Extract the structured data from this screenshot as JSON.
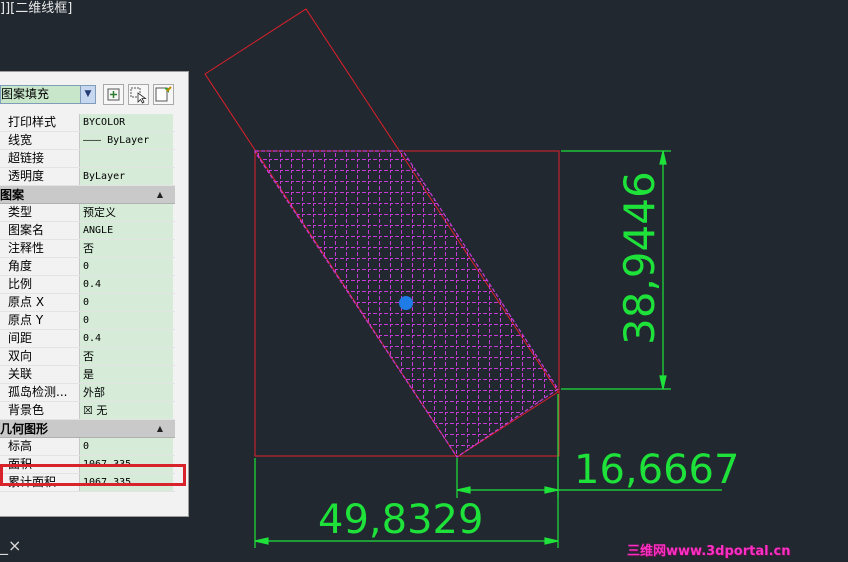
{
  "viewport": {
    "label": "]][二维线框]"
  },
  "palette": {
    "selected_object": "图案填充",
    "rows_general": [
      {
        "key": "打印样式",
        "value": "BYCOLOR"
      },
      {
        "key": "线宽",
        "value": "——— ByLayer"
      },
      {
        "key": "超链接",
        "value": ""
      },
      {
        "key": "透明度",
        "value": "ByLayer"
      }
    ],
    "section_pattern": "图案",
    "rows_pattern": [
      {
        "key": "类型",
        "value": "预定义"
      },
      {
        "key": "图案名",
        "value": "ANGLE"
      },
      {
        "key": "注释性",
        "value": "否"
      },
      {
        "key": "角度",
        "value": "0"
      },
      {
        "key": "比例",
        "value": "0.4"
      },
      {
        "key": "原点 X",
        "value": "0"
      },
      {
        "key": "原点 Y",
        "value": "0"
      },
      {
        "key": "间距",
        "value": "0.4"
      },
      {
        "key": "双向",
        "value": "否"
      },
      {
        "key": "关联",
        "value": "是"
      },
      {
        "key": "孤岛检测...",
        "value": "外部"
      },
      {
        "key": "背景色",
        "value": "☒ 无"
      }
    ],
    "section_geometry": "几何图形",
    "rows_geometry": [
      {
        "key": "标高",
        "value": "0"
      },
      {
        "key": "面积",
        "value": "1067.335"
      },
      {
        "key": "累计面积",
        "value": "1067.335"
      }
    ]
  },
  "drawing": {
    "dim_vertical": "38,9446",
    "dim_horizontal_right": "16,6667",
    "dim_horizontal_bottom": "49,8329",
    "colors": {
      "background": "#212830",
      "geometry": "#e0202a",
      "hatch": "#c43bd6",
      "dimension": "#1ee23a",
      "grip": "#1f7be6"
    }
  },
  "cmd": {
    "ucs_glyph": "_×"
  },
  "watermark": "三维网www.3dportal.cn"
}
